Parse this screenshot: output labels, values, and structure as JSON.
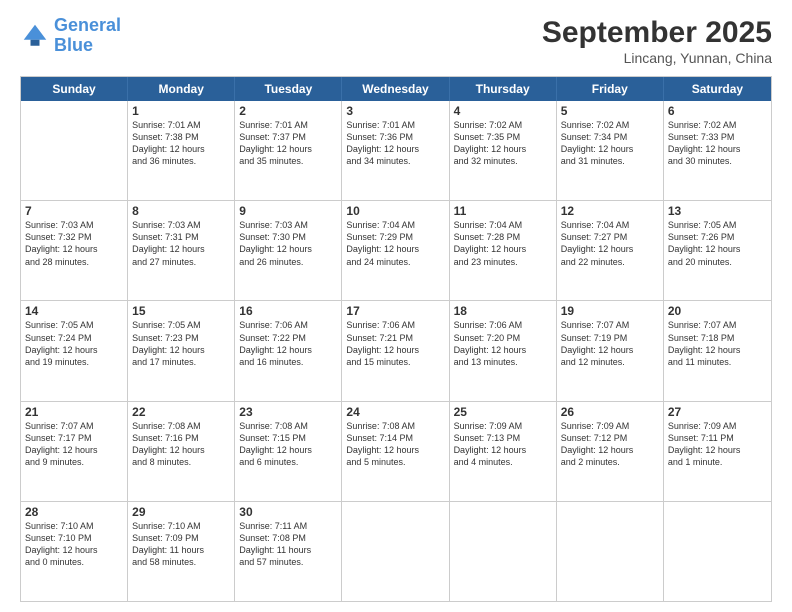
{
  "logo": {
    "line1": "General",
    "line2": "Blue"
  },
  "title": "September 2025",
  "subtitle": "Lincang, Yunnan, China",
  "days_of_week": [
    "Sunday",
    "Monday",
    "Tuesday",
    "Wednesday",
    "Thursday",
    "Friday",
    "Saturday"
  ],
  "weeks": [
    [
      {
        "day": "",
        "info": ""
      },
      {
        "day": "1",
        "info": "Sunrise: 7:01 AM\nSunset: 7:38 PM\nDaylight: 12 hours\nand 36 minutes."
      },
      {
        "day": "2",
        "info": "Sunrise: 7:01 AM\nSunset: 7:37 PM\nDaylight: 12 hours\nand 35 minutes."
      },
      {
        "day": "3",
        "info": "Sunrise: 7:01 AM\nSunset: 7:36 PM\nDaylight: 12 hours\nand 34 minutes."
      },
      {
        "day": "4",
        "info": "Sunrise: 7:02 AM\nSunset: 7:35 PM\nDaylight: 12 hours\nand 32 minutes."
      },
      {
        "day": "5",
        "info": "Sunrise: 7:02 AM\nSunset: 7:34 PM\nDaylight: 12 hours\nand 31 minutes."
      },
      {
        "day": "6",
        "info": "Sunrise: 7:02 AM\nSunset: 7:33 PM\nDaylight: 12 hours\nand 30 minutes."
      }
    ],
    [
      {
        "day": "7",
        "info": "Sunrise: 7:03 AM\nSunset: 7:32 PM\nDaylight: 12 hours\nand 28 minutes."
      },
      {
        "day": "8",
        "info": "Sunrise: 7:03 AM\nSunset: 7:31 PM\nDaylight: 12 hours\nand 27 minutes."
      },
      {
        "day": "9",
        "info": "Sunrise: 7:03 AM\nSunset: 7:30 PM\nDaylight: 12 hours\nand 26 minutes."
      },
      {
        "day": "10",
        "info": "Sunrise: 7:04 AM\nSunset: 7:29 PM\nDaylight: 12 hours\nand 24 minutes."
      },
      {
        "day": "11",
        "info": "Sunrise: 7:04 AM\nSunset: 7:28 PM\nDaylight: 12 hours\nand 23 minutes."
      },
      {
        "day": "12",
        "info": "Sunrise: 7:04 AM\nSunset: 7:27 PM\nDaylight: 12 hours\nand 22 minutes."
      },
      {
        "day": "13",
        "info": "Sunrise: 7:05 AM\nSunset: 7:26 PM\nDaylight: 12 hours\nand 20 minutes."
      }
    ],
    [
      {
        "day": "14",
        "info": "Sunrise: 7:05 AM\nSunset: 7:24 PM\nDaylight: 12 hours\nand 19 minutes."
      },
      {
        "day": "15",
        "info": "Sunrise: 7:05 AM\nSunset: 7:23 PM\nDaylight: 12 hours\nand 17 minutes."
      },
      {
        "day": "16",
        "info": "Sunrise: 7:06 AM\nSunset: 7:22 PM\nDaylight: 12 hours\nand 16 minutes."
      },
      {
        "day": "17",
        "info": "Sunrise: 7:06 AM\nSunset: 7:21 PM\nDaylight: 12 hours\nand 15 minutes."
      },
      {
        "day": "18",
        "info": "Sunrise: 7:06 AM\nSunset: 7:20 PM\nDaylight: 12 hours\nand 13 minutes."
      },
      {
        "day": "19",
        "info": "Sunrise: 7:07 AM\nSunset: 7:19 PM\nDaylight: 12 hours\nand 12 minutes."
      },
      {
        "day": "20",
        "info": "Sunrise: 7:07 AM\nSunset: 7:18 PM\nDaylight: 12 hours\nand 11 minutes."
      }
    ],
    [
      {
        "day": "21",
        "info": "Sunrise: 7:07 AM\nSunset: 7:17 PM\nDaylight: 12 hours\nand 9 minutes."
      },
      {
        "day": "22",
        "info": "Sunrise: 7:08 AM\nSunset: 7:16 PM\nDaylight: 12 hours\nand 8 minutes."
      },
      {
        "day": "23",
        "info": "Sunrise: 7:08 AM\nSunset: 7:15 PM\nDaylight: 12 hours\nand 6 minutes."
      },
      {
        "day": "24",
        "info": "Sunrise: 7:08 AM\nSunset: 7:14 PM\nDaylight: 12 hours\nand 5 minutes."
      },
      {
        "day": "25",
        "info": "Sunrise: 7:09 AM\nSunset: 7:13 PM\nDaylight: 12 hours\nand 4 minutes."
      },
      {
        "day": "26",
        "info": "Sunrise: 7:09 AM\nSunset: 7:12 PM\nDaylight: 12 hours\nand 2 minutes."
      },
      {
        "day": "27",
        "info": "Sunrise: 7:09 AM\nSunset: 7:11 PM\nDaylight: 12 hours\nand 1 minute."
      }
    ],
    [
      {
        "day": "28",
        "info": "Sunrise: 7:10 AM\nSunset: 7:10 PM\nDaylight: 12 hours\nand 0 minutes."
      },
      {
        "day": "29",
        "info": "Sunrise: 7:10 AM\nSunset: 7:09 PM\nDaylight: 11 hours\nand 58 minutes."
      },
      {
        "day": "30",
        "info": "Sunrise: 7:11 AM\nSunset: 7:08 PM\nDaylight: 11 hours\nand 57 minutes."
      },
      {
        "day": "",
        "info": ""
      },
      {
        "day": "",
        "info": ""
      },
      {
        "day": "",
        "info": ""
      },
      {
        "day": "",
        "info": ""
      }
    ]
  ]
}
